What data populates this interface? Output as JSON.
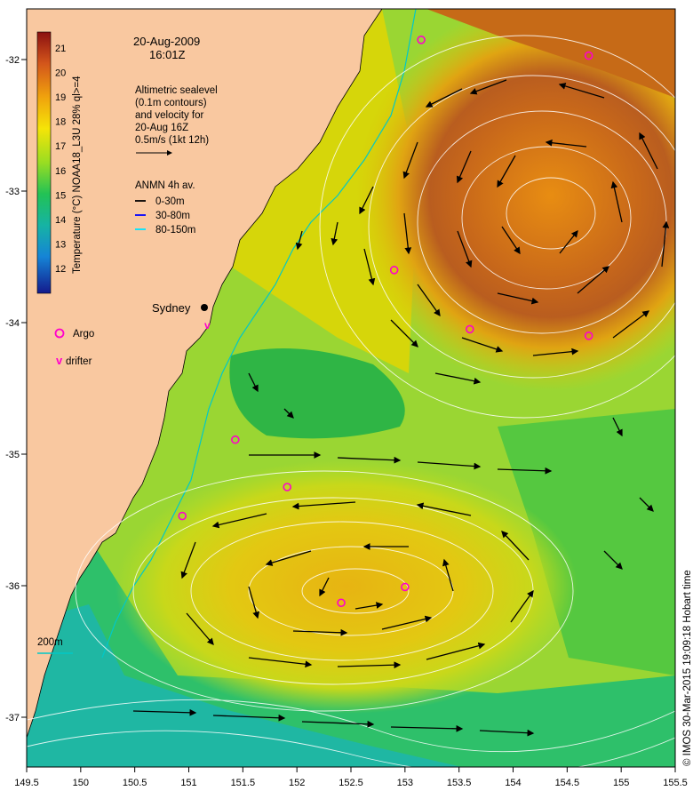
{
  "header": {
    "date": "20-Aug-2009",
    "time": "16:01Z"
  },
  "notes": {
    "line1": "Altimetric sealevel",
    "line2": "(0.1m contours)",
    "line3": "and velocity for",
    "line4": "20-Aug 16Z",
    "line5": "0.5m/s (1kt 12h)"
  },
  "anmn": {
    "title": "ANMN 4h av.",
    "items": [
      {
        "label": "0-30m",
        "color": "#000000"
      },
      {
        "label": "30-80m",
        "color": "#0000ff"
      },
      {
        "label": "80-150m",
        "color": "#00e5ff"
      }
    ]
  },
  "colorbar": {
    "label": "Temperature (°C) NOAA18_L3U 28% ql>=4",
    "ticks": [
      "21",
      "20",
      "19",
      "18",
      "17",
      "16",
      "15",
      "14",
      "13",
      "12"
    ]
  },
  "places": {
    "city": "Sydney"
  },
  "legend": {
    "argo": "Argo",
    "drifter_symbol": "v",
    "drifter": "drifter"
  },
  "isobath": {
    "label": "200m"
  },
  "credit": "© IMOS 30-Mar-2015 19:09:18 Hobart time",
  "axes": {
    "lon_ticks": [
      "149.5",
      "150",
      "150.5",
      "151",
      "151.5",
      "152",
      "152.5",
      "153",
      "153.5",
      "154",
      "154.5",
      "155",
      "155.5"
    ],
    "lat_ticks": [
      "-32",
      "-33",
      "-34",
      "-35",
      "-36",
      "-37"
    ]
  },
  "colors": {
    "land": "#f9c8a0",
    "warm": "#d6760f",
    "mid": "#d8d80a",
    "cool": "#4cc83c",
    "cold": "#1fb7a3",
    "argo": "#ff00cc",
    "isobath": "#00c8c8"
  },
  "argo_floats": [
    {
      "lon": 153.15,
      "lat": -31.85
    },
    {
      "lon": 154.7,
      "lat": -31.97
    },
    {
      "lon": 152.9,
      "lat": -33.6
    },
    {
      "lon": 153.6,
      "lat": -34.05
    },
    {
      "lon": 154.7,
      "lat": -34.1
    },
    {
      "lon": 151.43,
      "lat": -34.89
    },
    {
      "lon": 151.91,
      "lat": -35.25
    },
    {
      "lon": 150.94,
      "lat": -35.47
    },
    {
      "lon": 152.41,
      "lat": -36.13
    },
    {
      "lon": 153.0,
      "lat": -36.01
    }
  ]
}
